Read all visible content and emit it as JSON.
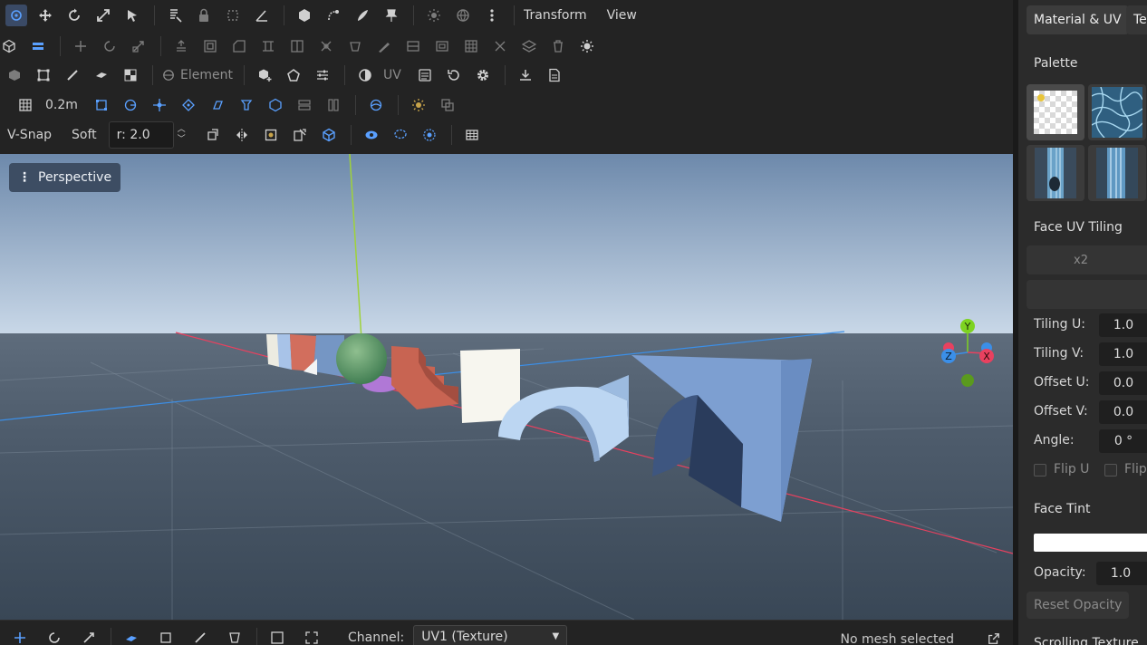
{
  "menus": {
    "transform": "Transform",
    "view": "View"
  },
  "row2": {
    "grid_size": "0.2m"
  },
  "row3": {
    "element_label": "Element",
    "uv_label": "UV"
  },
  "snap": {
    "vsnap": "V-Snap",
    "soft": "Soft",
    "radius_value": "r: 2.0"
  },
  "viewport": {
    "camera_label": "Perspective",
    "gizmo": {
      "y": "Y",
      "x": "X",
      "z": "Z"
    }
  },
  "bottom": {
    "channel_label": "Channel:",
    "channel_value": "UV1 (Texture)",
    "status": "No mesh selected"
  },
  "panel": {
    "tab1": "Material & UV",
    "tab2": "Te",
    "palette_title": "Palette",
    "face_uv_tiling": "Face UV Tiling",
    "x2_label": "x2",
    "tiling_u_label": "Tiling U:",
    "tiling_u": "1.0",
    "tiling_v_label": "Tiling V:",
    "tiling_v": "1.0",
    "offset_u_label": "Offset U:",
    "offset_u": "0.0",
    "offset_v_label": "Offset V:",
    "offset_v": "0.0",
    "angle_label": "Angle:",
    "angle": "0 °",
    "flip_u": "Flip U",
    "flip_v": "Flip",
    "face_tint": "Face Tint",
    "tint_color": "#ffffff",
    "opacity_label": "Opacity:",
    "opacity": "1.0",
    "reset_opacity": "Reset Opacity",
    "bottom_cut": "Scrolling Texture"
  },
  "colors": {
    "accent": "#5aa0ff",
    "axis_x": "#e8415f",
    "axis_y": "#7ed321",
    "axis_z": "#3b8fe8"
  }
}
